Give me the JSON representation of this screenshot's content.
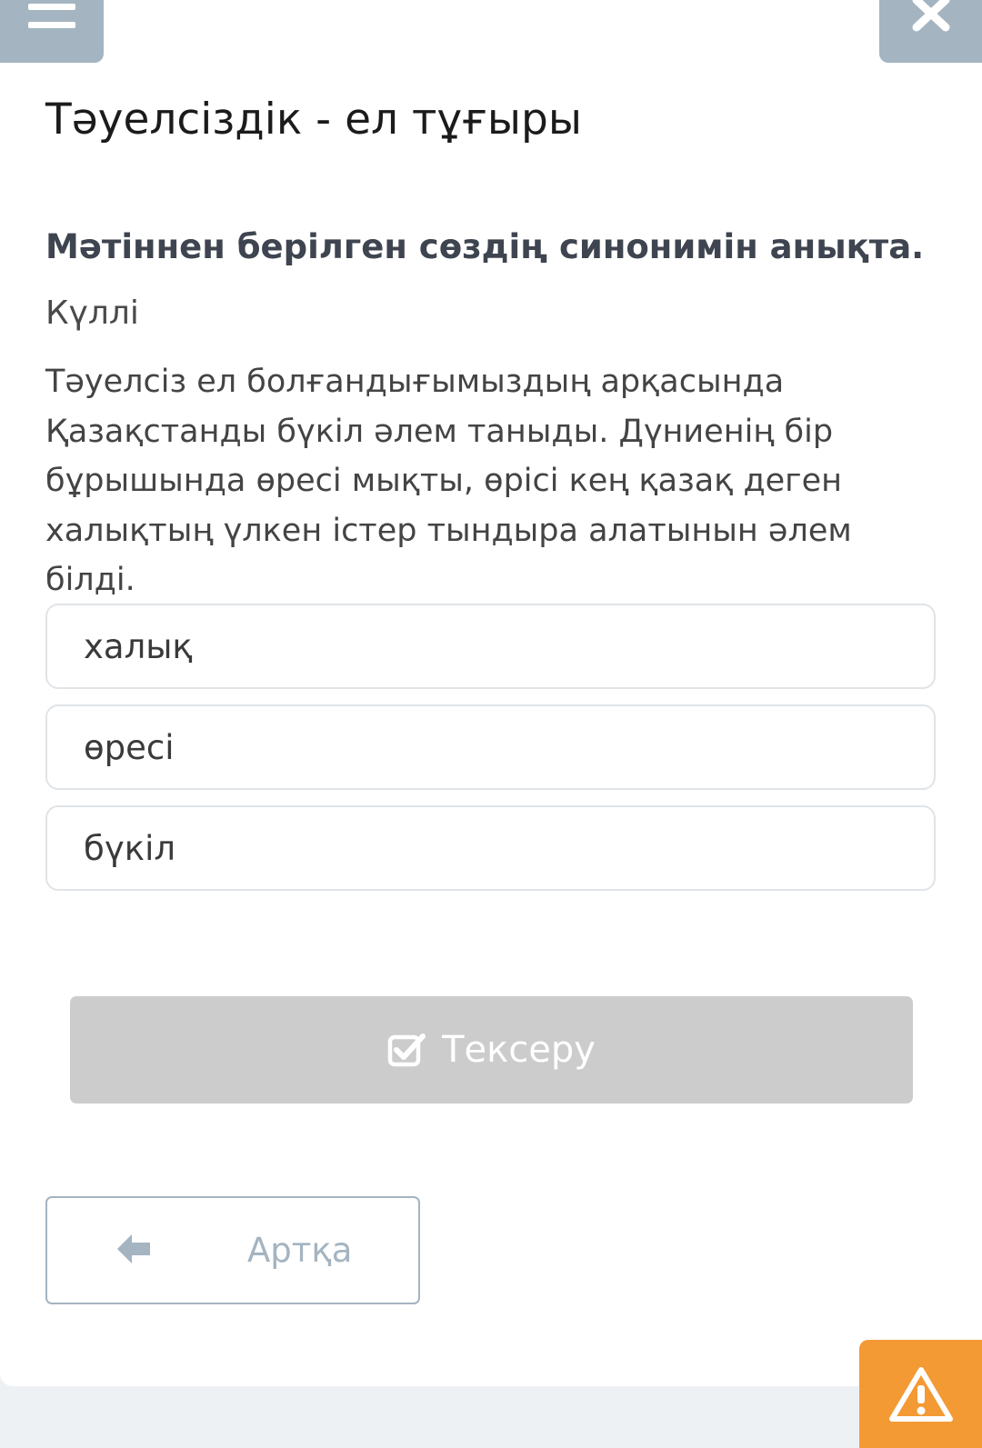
{
  "header": {
    "menu_icon": "hamburger-menu-icon",
    "close_icon": "close-x-icon",
    "title": "Тәуелсіздік - ел тұғыры"
  },
  "task": {
    "question": "Мәтіннен берілген сөздің синонимін анықта.",
    "word": "Күллі",
    "passage": "Тәуелсіз ел болғандығымыздың арқасында Қазақстанды бүкіл әлем таныды. Дүниенің бір бұрышында өресі мықты, өрісі кең қазақ деген халықтың үлкен істер тындыра алатынын әлем білді."
  },
  "options": [
    {
      "label": "халық"
    },
    {
      "label": "өресі"
    },
    {
      "label": "бүкіл"
    }
  ],
  "actions": {
    "check_label": "Тексеру",
    "check_icon": "checkbox-check-icon",
    "back_label": "Артқа",
    "back_icon": "arrow-left-icon",
    "report_icon": "warning-triangle-icon"
  },
  "colors": {
    "header_button": "#a4b4c1",
    "check_button_disabled": "#cccccc",
    "report_button": "#f39a34",
    "option_border": "#e0e4e8"
  }
}
